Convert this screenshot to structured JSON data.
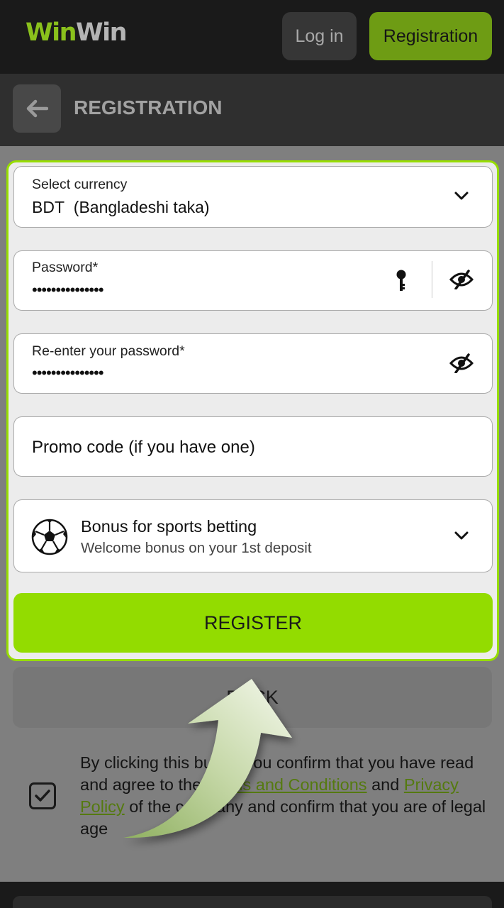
{
  "header": {
    "logo_part1": "Win",
    "logo_part2": "Win",
    "login_label": "Log in",
    "registration_label": "Registration"
  },
  "subheader": {
    "title": "REGISTRATION"
  },
  "form": {
    "currency": {
      "label": "Select currency",
      "code": "BDT",
      "name": "(Bangladeshi taka)"
    },
    "password": {
      "label": "Password*",
      "masked_value": "•••••••••••••••"
    },
    "reenter_password": {
      "label": "Re-enter your password*",
      "masked_value": "•••••••••••••••"
    },
    "promo": {
      "placeholder": "Promo code (if you have one)"
    },
    "bonus": {
      "title": "Bonus for sports betting",
      "subtitle": "Welcome bonus on your 1st deposit"
    },
    "register_label": "REGISTER"
  },
  "back_label": "BACK",
  "terms": {
    "checked": true,
    "text_before": "By clicking this button you confirm that you have read and agree to the ",
    "terms_link": "Terms and Conditions",
    "text_middle": " and ",
    "privacy_link": "Privacy Policy",
    "text_after": " of the company and confirm that you are of legal age"
  },
  "colors": {
    "accent": "#93dc00",
    "accent_dark": "#6e9c14",
    "header_bg": "#1a1a1a",
    "overlay_bg": "#7f7f7f"
  }
}
